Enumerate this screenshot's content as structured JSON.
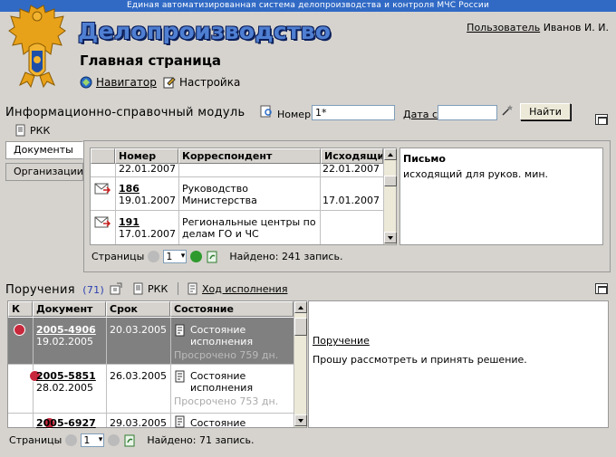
{
  "header": {
    "system_name": "Единая автоматизированная система делопроизводства и контроля МЧС России",
    "app_title": "Делопроизводство",
    "page_title": "Главная страница",
    "user_link": "Пользователь",
    "user_name": "Иванов И. И.",
    "nav": [
      {
        "label": "Навигатор",
        "icon": "navigator-icon"
      },
      {
        "label": "Настройка",
        "icon": "settings-icon"
      }
    ]
  },
  "info_module": {
    "title": "Информационно-справочный модуль",
    "number_label": "Номер",
    "number_value": "1*",
    "date_label": "Дата с",
    "date_value": "",
    "find_button": "Найти",
    "rkk_label": "РКК",
    "tabs": [
      "Документы",
      "Организации"
    ],
    "columns": [
      "Номер",
      "Корреспондент",
      "Исходящий"
    ],
    "rows": [
      {
        "number": "",
        "date": "22.01.2007",
        "correspondent": "",
        "outgoing": "22.01.2007",
        "partial": true
      },
      {
        "number": "186",
        "date": "19.01.2007",
        "correspondent": "Руководство Министерства",
        "outgoing": "17.01.2007"
      },
      {
        "number": "191",
        "date": "17.01.2007",
        "correspondent": "Региональные центры по делам ГО и ЧС",
        "outgoing": ""
      }
    ],
    "preview_title": "Письмо",
    "preview_text": "исходящий для руков. мин.",
    "pages_label": "Страницы",
    "page_value": "1",
    "found_text": "Найдено: 241 запись."
  },
  "assignments": {
    "title": "Поручения",
    "count": "(71)",
    "rkk_label": "РКК",
    "progress_label": "Ход исполнения",
    "columns": [
      "К",
      "Документ",
      "Срок",
      "Состояние"
    ],
    "rows": [
      {
        "doc": "2005-4906",
        "date": "19.02.2005",
        "deadline": "20.03.2005",
        "state": "Состояние исполнения",
        "overdue": "Просрочено 759 дн.",
        "selected": true
      },
      {
        "doc": "2005-5851",
        "date": "28.02.2005",
        "deadline": "26.03.2005",
        "state": "Состояние исполнения",
        "overdue": "Просрочено 753 дн.",
        "selected": false
      },
      {
        "doc": "2005-6927",
        "date": "",
        "deadline": "29.03.2005",
        "state": "Состояние",
        "overdue": "",
        "selected": false
      }
    ],
    "preview_title": "Поручение",
    "preview_text": "Прошу рассмотреть и принять решение.",
    "pages_label": "Страницы",
    "page_value": "1",
    "found_text": "Найдено: 71 запись."
  },
  "colors": {
    "title_blue": "#4f7fd2",
    "top_bar": "#316ac5",
    "background": "#d6d3ce",
    "selected_row": "#808080"
  }
}
